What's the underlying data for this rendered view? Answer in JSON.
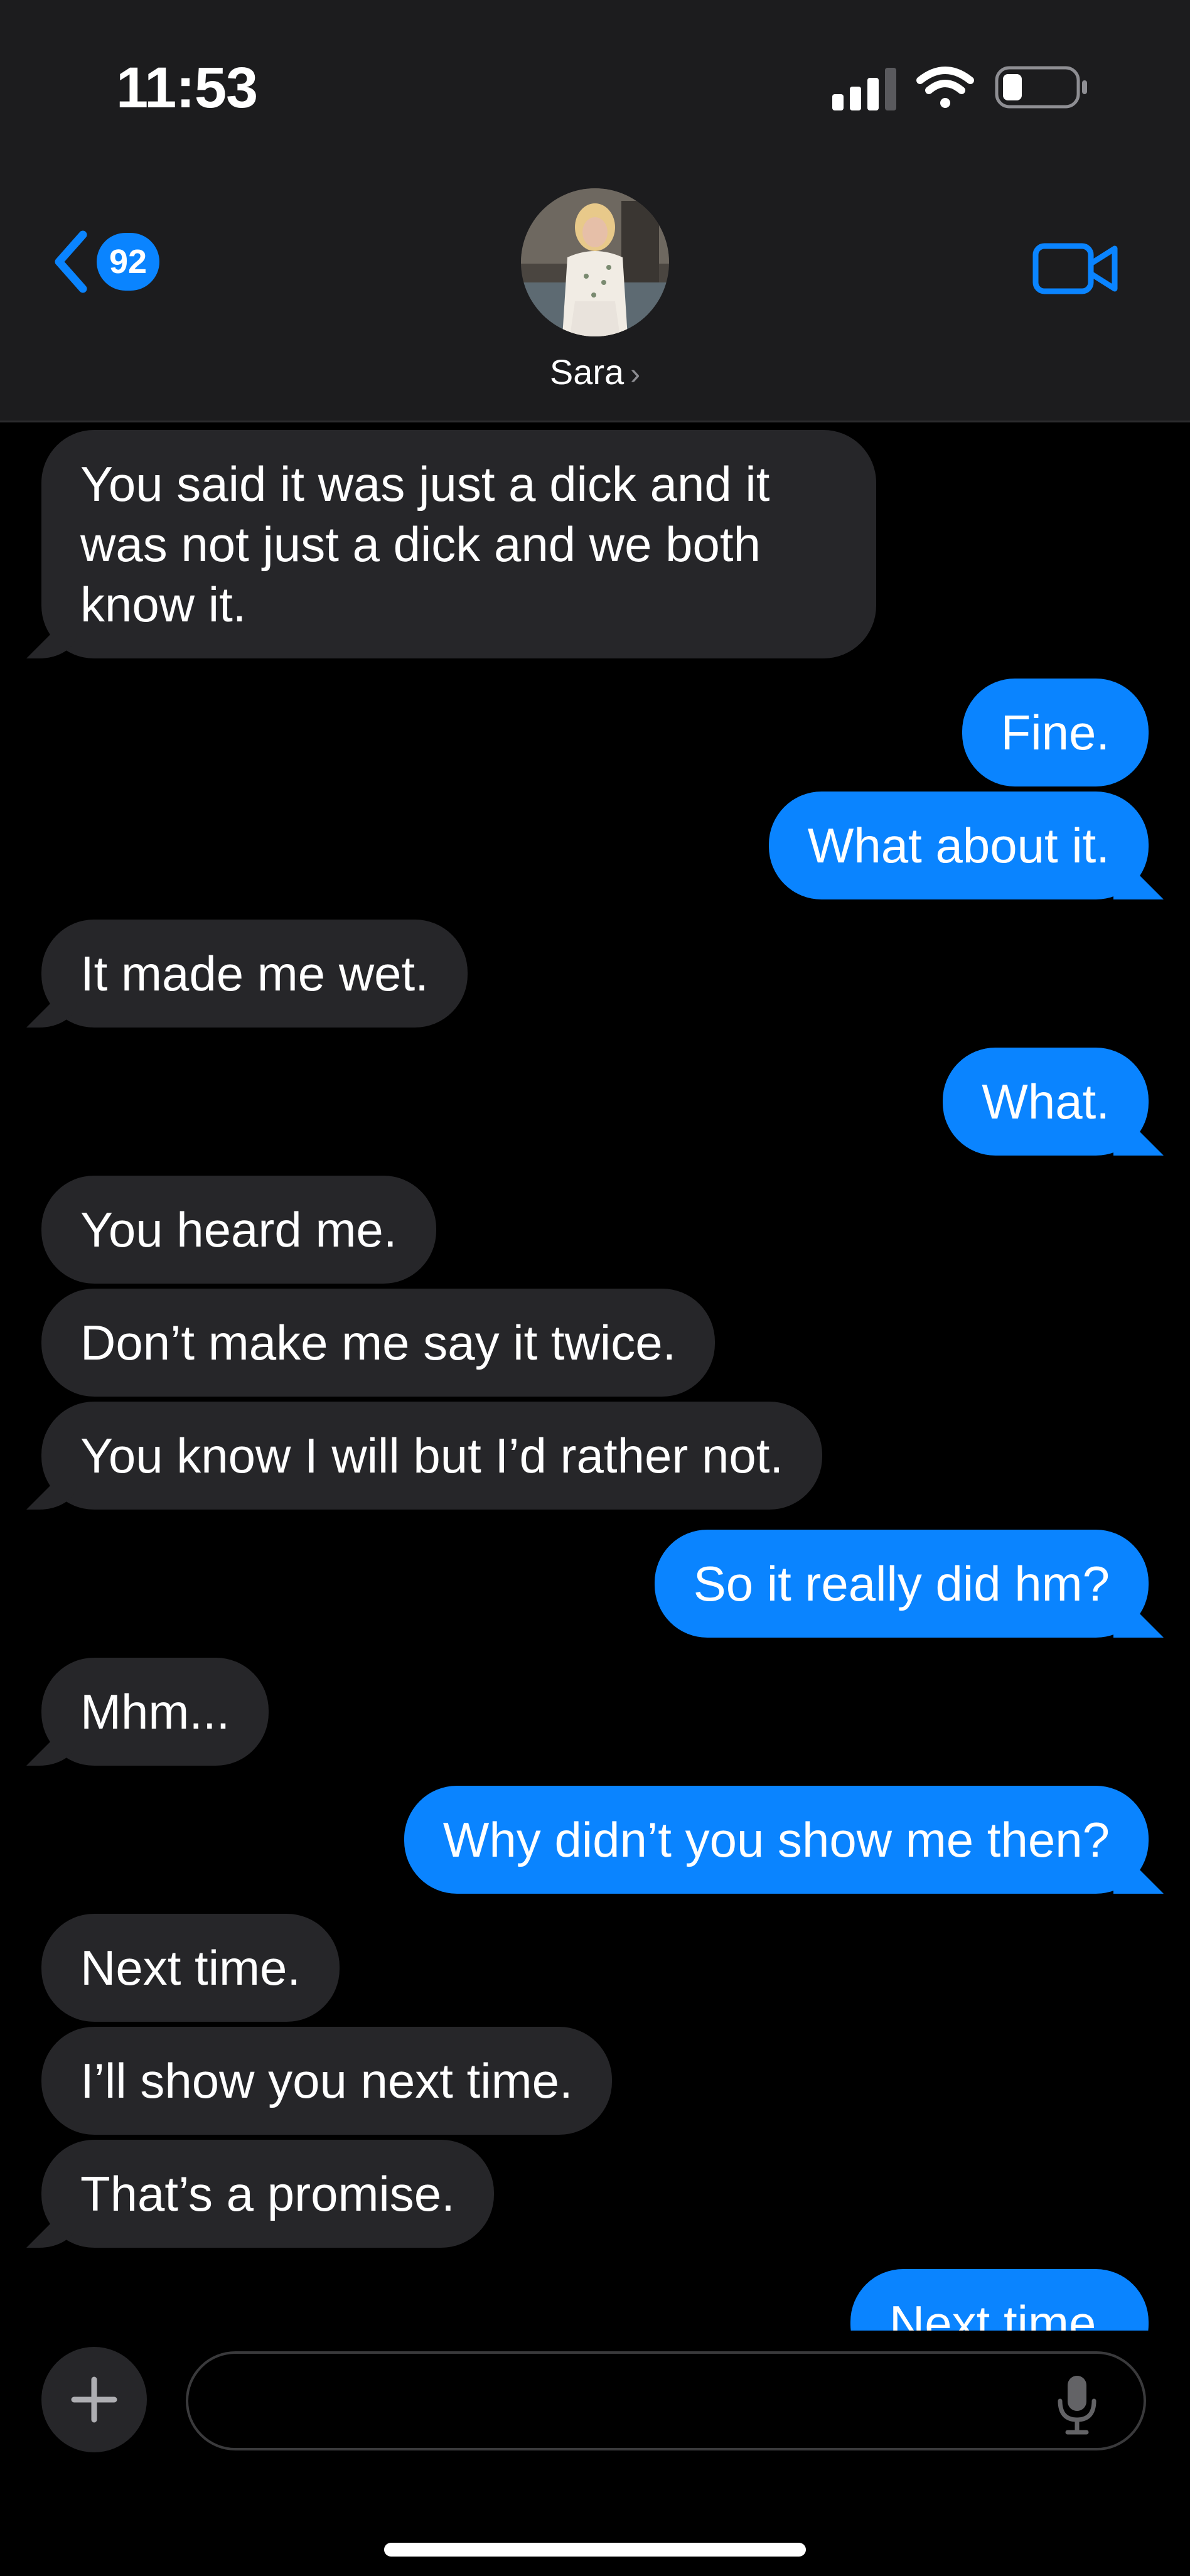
{
  "status_bar": {
    "time": "11:53",
    "icons": [
      "cellular-signal-icon",
      "wifi-icon",
      "battery-icon"
    ]
  },
  "header": {
    "back_badge_count": "92",
    "contact_name": "Sara",
    "icons": [
      "chevron-left-icon",
      "video-camera-icon",
      "chevron-right-icon"
    ]
  },
  "messages": [
    {
      "from": "them",
      "text": "You said it was just a dick and it was not just a dick and we both know it."
    },
    {
      "from": "me",
      "text": "Fine."
    },
    {
      "from": "me",
      "text": "What about it."
    },
    {
      "from": "them",
      "text": "It made me wet."
    },
    {
      "from": "me",
      "text": "What."
    },
    {
      "from": "them",
      "text": "You heard me."
    },
    {
      "from": "them",
      "text": "Don’t make me say it twice."
    },
    {
      "from": "them",
      "text": "You know I will but I’d rather not."
    },
    {
      "from": "me",
      "text": "So it really did hm?"
    },
    {
      "from": "them",
      "text": "Mhm..."
    },
    {
      "from": "me",
      "text": "Why didn’t you show me then?"
    },
    {
      "from": "them",
      "text": "Next time."
    },
    {
      "from": "them",
      "text": "I’ll show you next time."
    },
    {
      "from": "them",
      "text": "That’s a promise."
    },
    {
      "from": "me",
      "text": "Next time."
    }
  ],
  "composer": {
    "input_value": "",
    "icons": [
      "plus-icon",
      "microphone-icon"
    ]
  },
  "colors": {
    "accent": "#0a84ff",
    "incoming_bubble": "#262629",
    "header_bg": "#1c1c1e",
    "background": "#000000"
  }
}
